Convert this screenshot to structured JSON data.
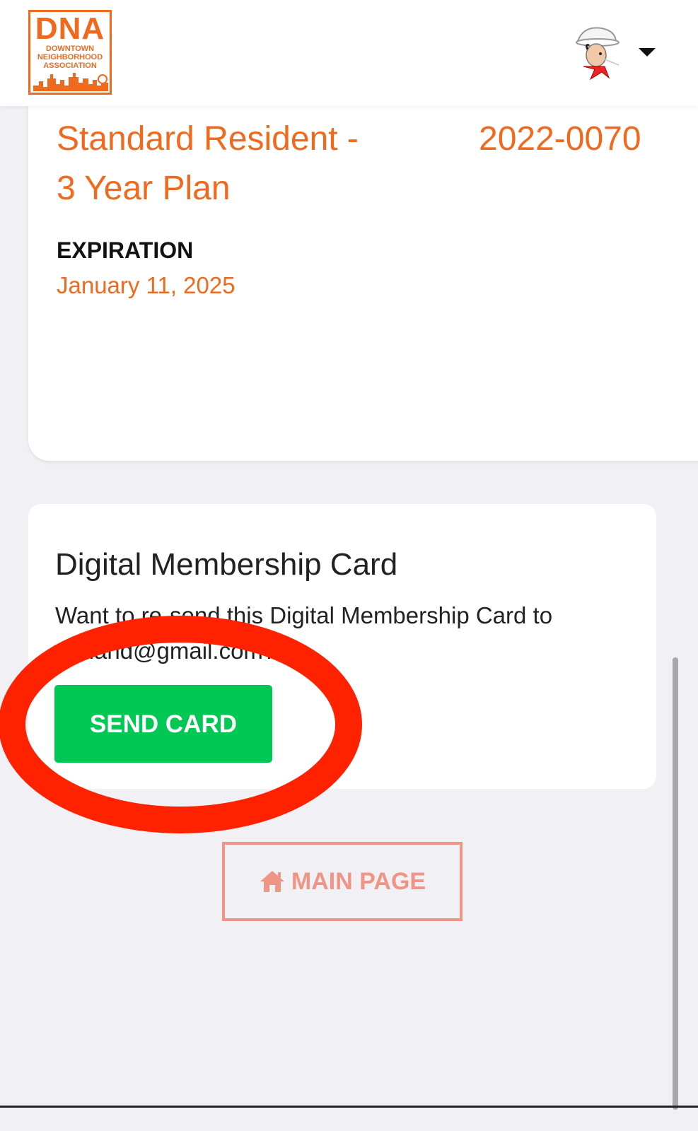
{
  "header": {
    "logo": {
      "big": "DNA",
      "small": "DOWNTOWN\nNEIGHBORHOOD\nASSOCIATION"
    },
    "avatar_icon": "cartoon-cowboy-avatar",
    "menu_icon": "caret-down-icon"
  },
  "membership": {
    "plan": "Standard Resident - 3 Year Plan",
    "number": "2022-0070",
    "expiration_label": "EXPIRATION",
    "expiration_date": "January 11, 2025"
  },
  "digital_card": {
    "title": "Digital Membership Card",
    "description_line1": "Want to re-send this Digital Membership Card to",
    "description_line2": "...mand@gmail.com?",
    "send_button": "SEND CARD"
  },
  "footer": {
    "main_page_button": "MAIN PAGE",
    "home_icon": "home-icon"
  },
  "colors": {
    "accent": "#f06a1e",
    "send_button": "#00c853",
    "main_page": "#ef9585",
    "annotation": "#ff2200"
  }
}
